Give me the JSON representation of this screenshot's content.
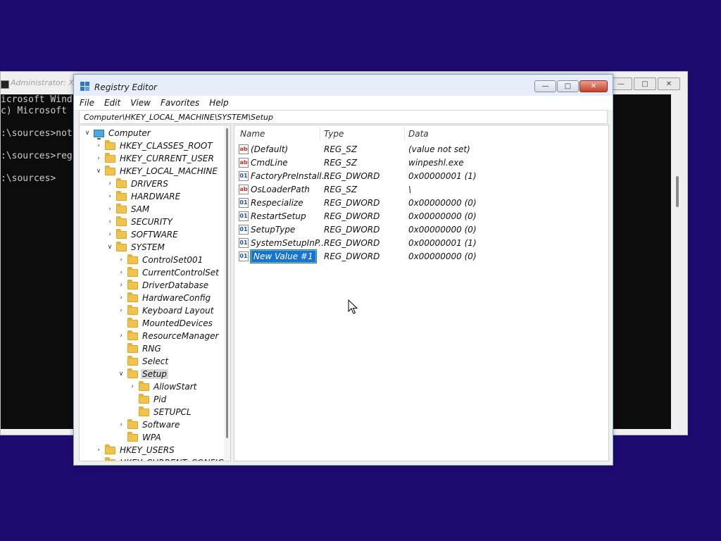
{
  "cmd": {
    "title": "Administrator: X:",
    "lines": [
      "icrosoft Wind",
      "c) Microsoft",
      "",
      ":\\sources>not",
      "",
      ":\\sources>reg",
      "",
      ":\\sources>"
    ]
  },
  "regedit": {
    "title": "Registry Editor",
    "menu": [
      "File",
      "Edit",
      "View",
      "Favorites",
      "Help"
    ],
    "address": "Computer\\HKEY_LOCAL_MACHINE\\SYSTEM\\Setup",
    "tree": [
      {
        "label": "Computer",
        "level": 0,
        "expander": "v",
        "icon": "computer-icon"
      },
      {
        "label": "HKEY_CLASSES_ROOT",
        "level": 1,
        "expander": ">",
        "icon": "folder-icon"
      },
      {
        "label": "HKEY_CURRENT_USER",
        "level": 1,
        "expander": ">",
        "icon": "folder-icon"
      },
      {
        "label": "HKEY_LOCAL_MACHINE",
        "level": 1,
        "expander": "v",
        "icon": "folder-icon"
      },
      {
        "label": "DRIVERS",
        "level": 2,
        "expander": ">",
        "icon": "folder-icon"
      },
      {
        "label": "HARDWARE",
        "level": 2,
        "expander": ">",
        "icon": "folder-icon"
      },
      {
        "label": "SAM",
        "level": 2,
        "expander": ">",
        "icon": "folder-icon"
      },
      {
        "label": "SECURITY",
        "level": 2,
        "expander": ">",
        "icon": "folder-icon"
      },
      {
        "label": "SOFTWARE",
        "level": 2,
        "expander": ">",
        "icon": "folder-icon"
      },
      {
        "label": "SYSTEM",
        "level": 2,
        "expander": "v",
        "icon": "folder-icon"
      },
      {
        "label": "ControlSet001",
        "level": 3,
        "expander": ">",
        "icon": "folder-icon"
      },
      {
        "label": "CurrentControlSet",
        "level": 3,
        "expander": ">",
        "icon": "folder-icon"
      },
      {
        "label": "DriverDatabase",
        "level": 3,
        "expander": ">",
        "icon": "folder-icon"
      },
      {
        "label": "HardwareConfig",
        "level": 3,
        "expander": ">",
        "icon": "folder-icon"
      },
      {
        "label": "Keyboard Layout",
        "level": 3,
        "expander": ">",
        "icon": "folder-icon"
      },
      {
        "label": "MountedDevices",
        "level": 3,
        "expander": "",
        "icon": "folder-icon"
      },
      {
        "label": "ResourceManager",
        "level": 3,
        "expander": ">",
        "icon": "folder-icon"
      },
      {
        "label": "RNG",
        "level": 3,
        "expander": "",
        "icon": "folder-icon"
      },
      {
        "label": "Select",
        "level": 3,
        "expander": "",
        "icon": "folder-icon"
      },
      {
        "label": "Setup",
        "level": 3,
        "expander": "v",
        "icon": "folder-icon",
        "selected": true
      },
      {
        "label": "AllowStart",
        "level": 4,
        "expander": ">",
        "icon": "folder-icon"
      },
      {
        "label": "Pid",
        "level": 4,
        "expander": "",
        "icon": "folder-icon"
      },
      {
        "label": "SETUPCL",
        "level": 4,
        "expander": "",
        "icon": "folder-icon"
      },
      {
        "label": "Software",
        "level": 3,
        "expander": ">",
        "icon": "folder-icon"
      },
      {
        "label": "WPA",
        "level": 3,
        "expander": "",
        "icon": "folder-icon"
      },
      {
        "label": "HKEY_USERS",
        "level": 1,
        "expander": ">",
        "icon": "folder-icon"
      },
      {
        "label": "HKEY_CURRENT_CONFIG",
        "level": 1,
        "expander": ">",
        "icon": "folder-icon"
      }
    ],
    "columns": {
      "name": "Name",
      "type": "Type",
      "data": "Data"
    },
    "values": [
      {
        "name": "(Default)",
        "type": "REG_SZ",
        "data": "(value not set)",
        "icon": "ab"
      },
      {
        "name": "CmdLine",
        "type": "REG_SZ",
        "data": "winpeshl.exe",
        "icon": "ab"
      },
      {
        "name": "FactoryPreInstall...",
        "type": "REG_DWORD",
        "data": "0x00000001 (1)",
        "icon": "01"
      },
      {
        "name": "OsLoaderPath",
        "type": "REG_SZ",
        "data": "\\",
        "icon": "ab"
      },
      {
        "name": "Respecialize",
        "type": "REG_DWORD",
        "data": "0x00000000 (0)",
        "icon": "01"
      },
      {
        "name": "RestartSetup",
        "type": "REG_DWORD",
        "data": "0x00000000 (0)",
        "icon": "01"
      },
      {
        "name": "SetupType",
        "type": "REG_DWORD",
        "data": "0x00000000 (0)",
        "icon": "01"
      },
      {
        "name": "SystemSetupInP...",
        "type": "REG_DWORD",
        "data": "0x00000001 (1)",
        "icon": "01"
      },
      {
        "name": "New Value #1",
        "type": "REG_DWORD",
        "data": "0x00000000 (0)",
        "icon": "01",
        "editing": true
      }
    ]
  }
}
